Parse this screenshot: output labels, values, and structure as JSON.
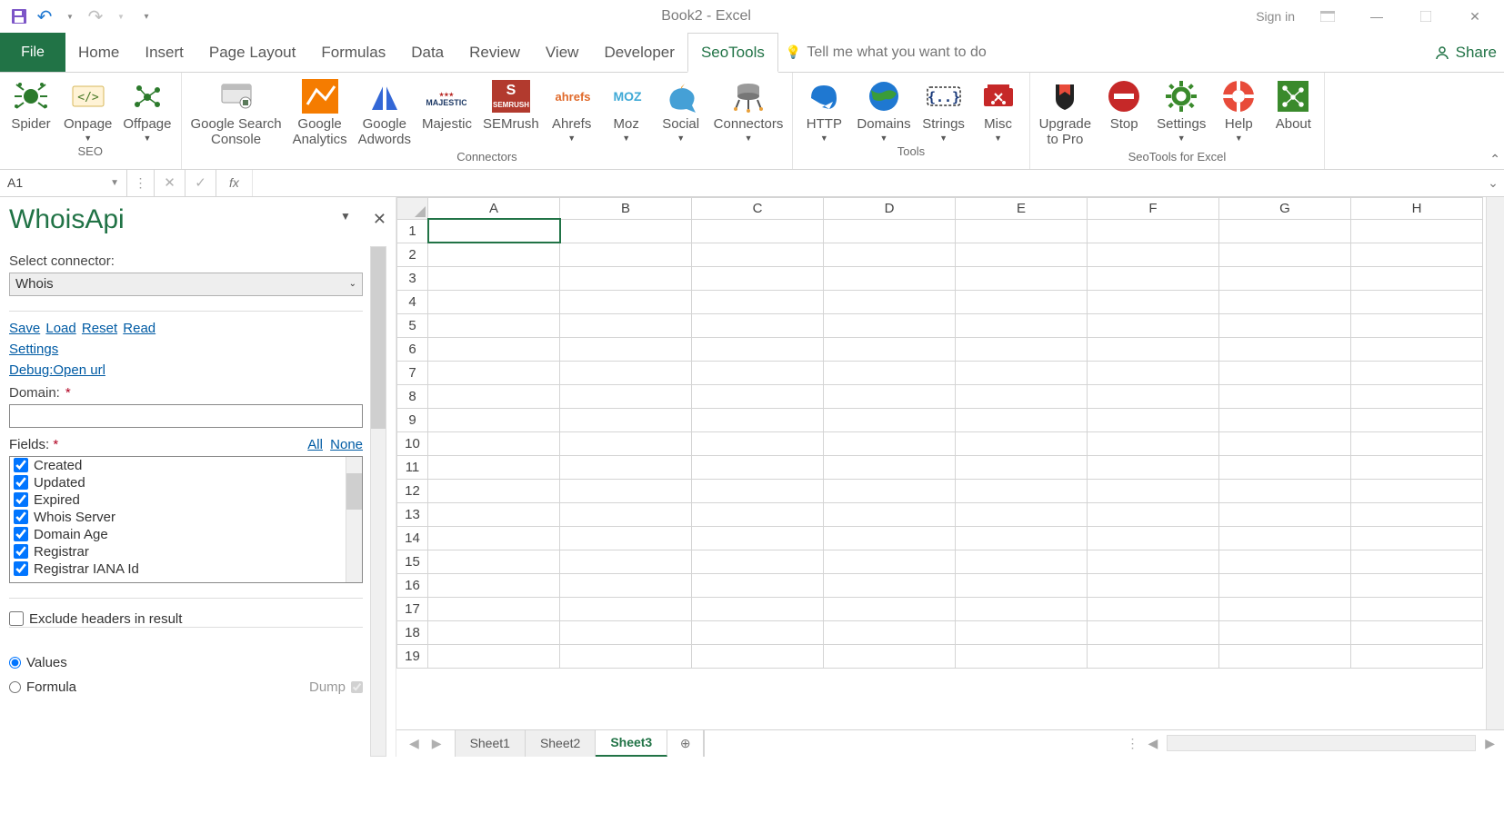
{
  "titlebar": {
    "title": "Book2  -  Excel",
    "signin": "Sign in"
  },
  "tabs": {
    "file": "File",
    "items": [
      "Home",
      "Insert",
      "Page Layout",
      "Formulas",
      "Data",
      "Review",
      "View",
      "Developer",
      "SeoTools"
    ],
    "active": "SeoTools",
    "tellme_placeholder": "Tell me what you want to do",
    "share": "Share"
  },
  "ribbon": {
    "groups": [
      {
        "label": "SEO",
        "items": [
          {
            "id": "spider",
            "label": "Spider",
            "dd": false
          },
          {
            "id": "onpage",
            "label": "Onpage",
            "dd": true
          },
          {
            "id": "offpage",
            "label": "Offpage",
            "dd": true
          }
        ]
      },
      {
        "label": "Connectors",
        "items": [
          {
            "id": "gsc",
            "label": "Google Search\nConsole",
            "dd": false
          },
          {
            "id": "ga",
            "label": "Google\nAnalytics",
            "dd": false
          },
          {
            "id": "gaw",
            "label": "Google\nAdwords",
            "dd": false
          },
          {
            "id": "majestic",
            "label": "Majestic",
            "dd": false
          },
          {
            "id": "semrush",
            "label": "SEMrush",
            "dd": false
          },
          {
            "id": "ahrefs",
            "label": "Ahrefs",
            "dd": true
          },
          {
            "id": "moz",
            "label": "Moz",
            "dd": true
          },
          {
            "id": "social",
            "label": "Social",
            "dd": true
          },
          {
            "id": "connectors",
            "label": "Connectors",
            "dd": true
          }
        ]
      },
      {
        "label": "Tools",
        "items": [
          {
            "id": "http",
            "label": "HTTP",
            "dd": true
          },
          {
            "id": "domains",
            "label": "Domains",
            "dd": true
          },
          {
            "id": "strings",
            "label": "Strings",
            "dd": true
          },
          {
            "id": "misc",
            "label": "Misc",
            "dd": true
          }
        ]
      },
      {
        "label": "SeoTools for Excel",
        "items": [
          {
            "id": "upgrade",
            "label": "Upgrade\nto Pro",
            "dd": false
          },
          {
            "id": "stop",
            "label": "Stop",
            "dd": false
          },
          {
            "id": "settings",
            "label": "Settings",
            "dd": true
          },
          {
            "id": "help",
            "label": "Help",
            "dd": true
          },
          {
            "id": "about",
            "label": "About",
            "dd": false
          }
        ]
      }
    ]
  },
  "namebox": "A1",
  "fx": "fx",
  "pane": {
    "title": "WhoisApi",
    "select_connector_label": "Select connector:",
    "connector_value": "Whois",
    "links": {
      "save": "Save",
      "load": "Load",
      "reset": "Reset",
      "read": "Read"
    },
    "settings": "Settings",
    "debug": "Debug:Open url",
    "domain_label": "Domain:",
    "fields_label": "Fields:",
    "all": "All",
    "none": "None",
    "fields": [
      "Created",
      "Updated",
      "Expired",
      "Whois Server",
      "Domain Age",
      "Registrar",
      "Registrar IANA Id"
    ],
    "exclude_headers": "Exclude headers in result",
    "radio_values": "Values",
    "radio_formula": "Formula",
    "dump": "Dump"
  },
  "sheet": {
    "cols": [
      "A",
      "B",
      "C",
      "D",
      "E",
      "F",
      "G",
      "H"
    ],
    "rows": [
      "1",
      "2",
      "3",
      "4",
      "5",
      "6",
      "7",
      "8",
      "9",
      "10",
      "11",
      "12",
      "13",
      "14",
      "15",
      "16",
      "17",
      "18",
      "19"
    ],
    "tabs": [
      "Sheet1",
      "Sheet2",
      "Sheet3"
    ],
    "active_tab": "Sheet3"
  }
}
